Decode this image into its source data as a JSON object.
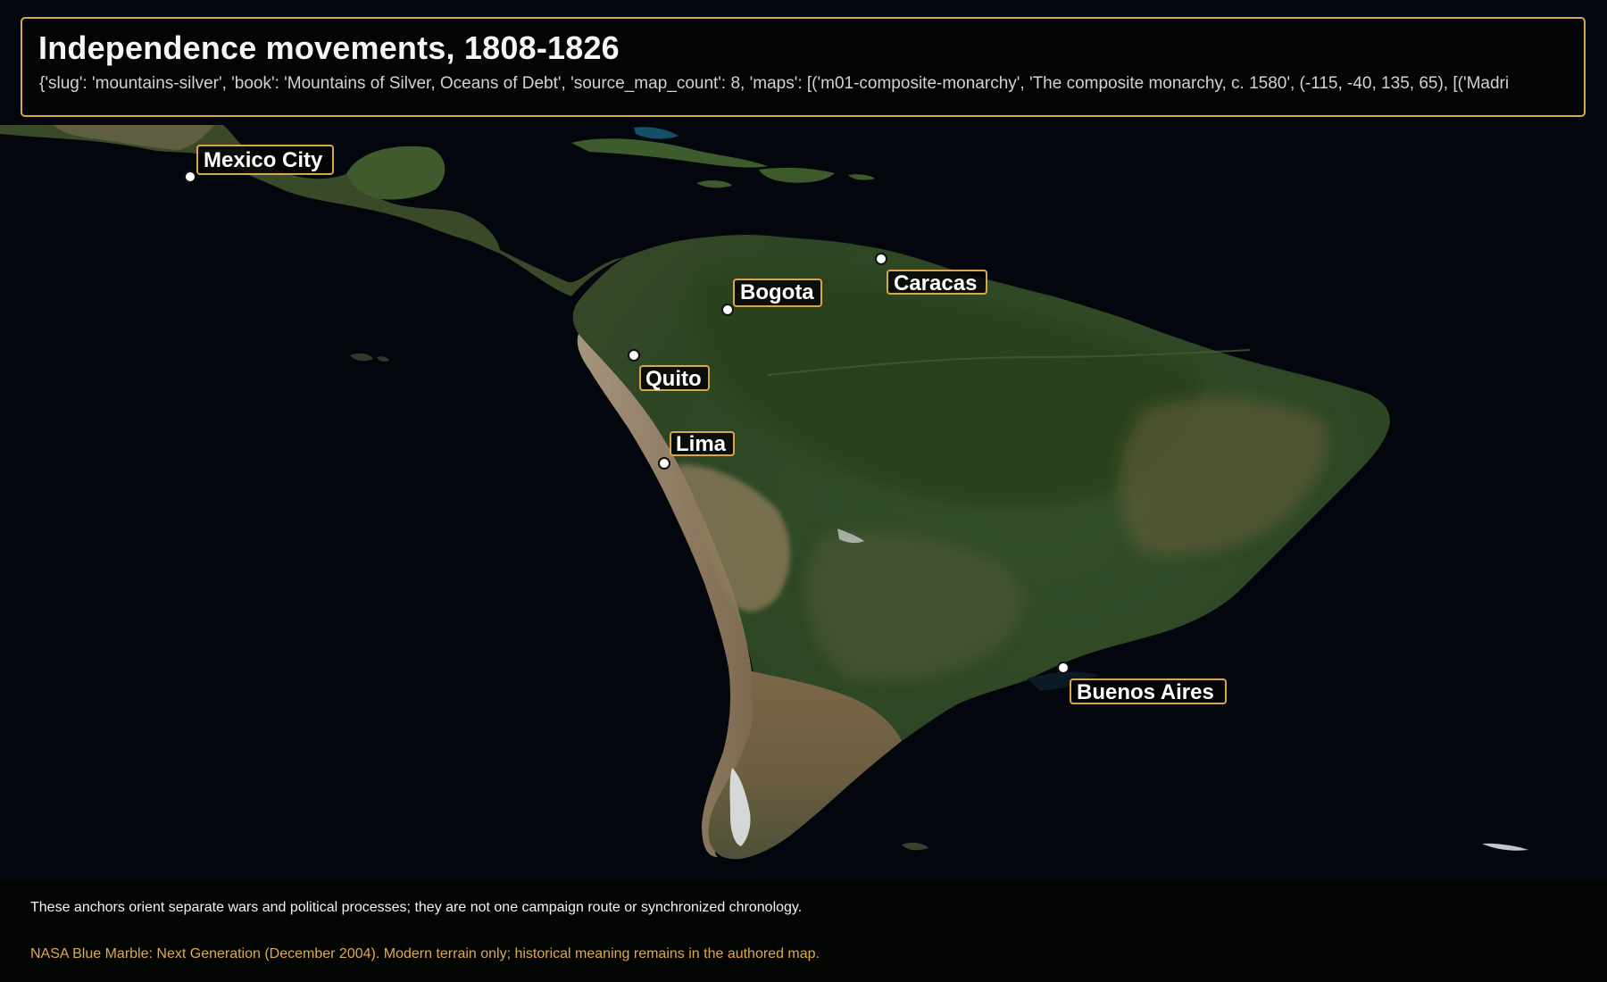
{
  "map": {
    "title": "Independence movements, 1808-1826",
    "subtitle": "{'slug': 'mountains-silver', 'book': 'Mountains of Silver, Oceans of Debt', 'source_map_count': 8, 'maps': [('m01-composite-monarchy', 'The composite monarchy, c. 1580', (-115, -40, 135, 65), [('Madri",
    "basemap": "satellite relief of Central and South America",
    "colors": {
      "accent": "#d9a74a",
      "ocean": "#03060d",
      "land": "#2f4a24",
      "arid": "#8a7150",
      "marker": "#ffffff"
    },
    "cities": [
      {
        "name": "Mexico City"
      },
      {
        "name": "Caracas"
      },
      {
        "name": "Bogota"
      },
      {
        "name": "Quito"
      },
      {
        "name": "Lima"
      },
      {
        "name": "Buenos Aires"
      }
    ]
  },
  "footer": {
    "note": "These anchors orient separate wars and political processes; they are not one campaign route or synchronized chronology.",
    "credit": "NASA Blue Marble: Next Generation (December 2004). Modern terrain only; historical meaning remains in the authored map."
  }
}
